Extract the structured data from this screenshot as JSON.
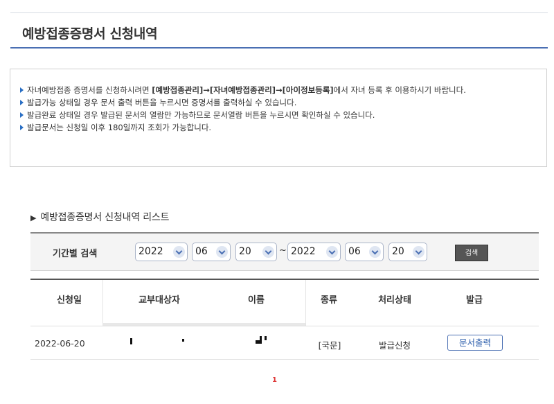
{
  "page_title": "예방접종증명서 신청내역",
  "notice": {
    "items": [
      {
        "pre": "자녀예방접종 증명서를 신청하시려면 ",
        "bold": "[예방접종관리]→[자녀예방접종관리]→[아이정보등록]",
        "post": "에서 자녀 등록 후 이용하시기 바랍니다."
      },
      {
        "text": "발급가능 상태일 경우 문서 출력 버튼을 누르시면 증명서를 출력하실 수 있습니다."
      },
      {
        "text": "발급완료 상태일 경우 발급된 문서의 열람만 가능하므로 문서열람 버튼을 누르시면 확인하실 수 있습니다."
      },
      {
        "text": "발급문서는 신청일 이후 180일까지 조회가 가능합니다."
      }
    ]
  },
  "list_title": "예방접종증명서 신청내역 리스트",
  "search": {
    "label": "기간별 검색",
    "from_year": "2022",
    "from_month": "06",
    "from_day": "20",
    "separator": "~",
    "to_year": "2022",
    "to_month": "06",
    "to_day": "20",
    "button": "검색"
  },
  "table": {
    "headers": [
      "신청일",
      "교부대상자",
      "이름",
      "종류",
      "처리상태",
      "발급"
    ],
    "rows": [
      {
        "date": "2022-06-20",
        "target": "",
        "name": "",
        "type": "[국문]",
        "status": "발급신청",
        "action": "문서출력"
      }
    ]
  },
  "pagination": {
    "current": "1"
  },
  "colors": {
    "accent": "#4a6fb3",
    "bullet": "#2a6fc4",
    "page": "#dd3333"
  }
}
